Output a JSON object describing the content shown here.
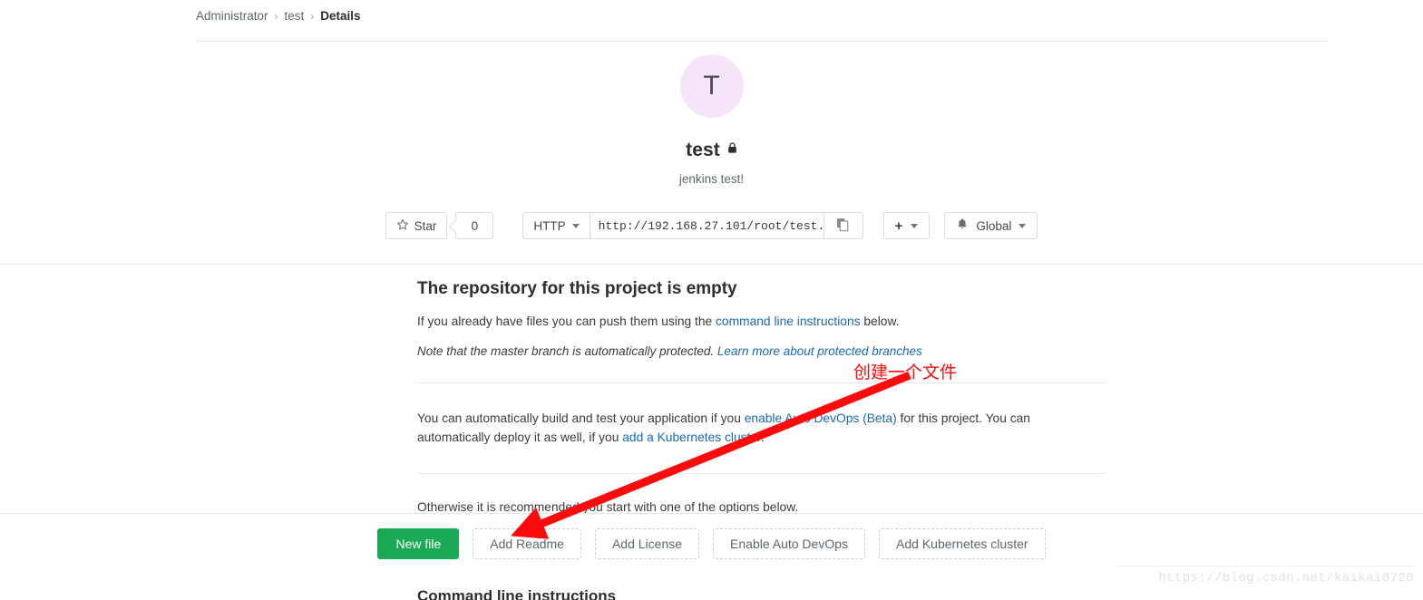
{
  "breadcrumb": {
    "items": [
      {
        "label": "Administrator",
        "current": false
      },
      {
        "label": "test",
        "current": false
      },
      {
        "label": "Details",
        "current": true
      }
    ],
    "separator": "›"
  },
  "project": {
    "avatar_initial": "T",
    "name": "test",
    "visibility_icon": "lock-icon",
    "description": "jenkins test!"
  },
  "actions": {
    "star_icon": "star-icon",
    "star_label": "Star",
    "star_count": "0",
    "clone_protocol": "HTTP",
    "clone_url": "http://192.168.27.101/root/test.",
    "copy_icon": "copy-icon",
    "plus_label": "+",
    "notification_icon": "bell-icon",
    "notification_label": "Global"
  },
  "empty_state": {
    "title": "The repository for this project is empty",
    "push_text_before": "If you already have files you can push them using the ",
    "push_link": "command line instructions",
    "push_text_after": " below.",
    "note_text": "Note that the master branch is automatically protected. ",
    "note_link": "Learn more about protected branches",
    "devops_text_1": "You can automatically build and test your application if you ",
    "devops_link_1": "enable Auto DevOps (Beta)",
    "devops_text_2": " for this project. You can automatically deploy it as well, if you ",
    "devops_link_2": "add a Kubernetes cluster",
    "devops_text_3": ".",
    "otherwise_text": "Otherwise it is recommended you start with one of the options below."
  },
  "options": {
    "new_file": "New file",
    "add_readme": "Add Readme",
    "add_license": "Add License",
    "enable_auto_devops": "Enable Auto DevOps",
    "add_kubernetes_cluster": "Add Kubernetes cluster"
  },
  "cli_section": {
    "heading": "Command line instructions"
  },
  "annotation": {
    "text": "创建一个文件",
    "color": "#fb0b0b"
  },
  "watermark": {
    "text": "https://blog.csdn.net/kaikai0720"
  },
  "colors": {
    "accent_green": "#1aaa55",
    "link_blue": "#1b69b6",
    "avatar_bg": "#f4e6f7",
    "annotation_red": "#fb0b0b"
  }
}
